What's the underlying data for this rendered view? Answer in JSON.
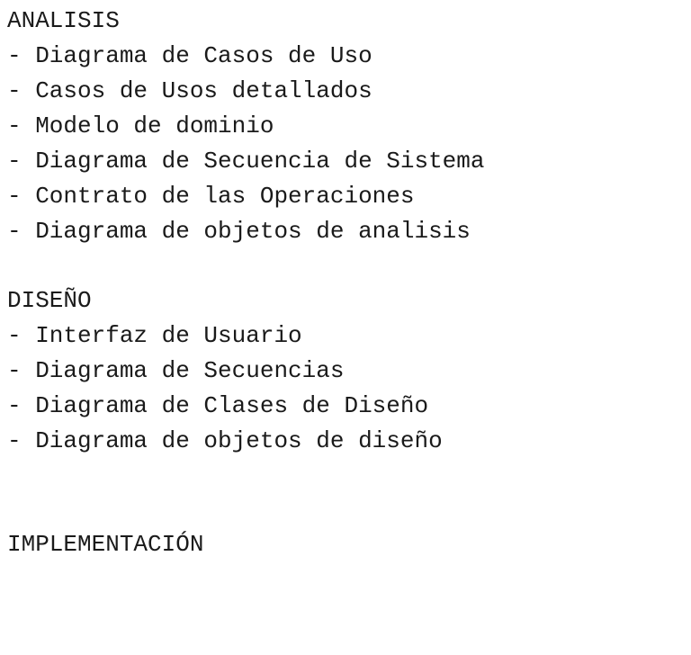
{
  "sections": [
    {
      "title": "ANALISIS",
      "items": [
        "- Diagrama de Casos de Uso",
        "- Casos de Usos detallados",
        "- Modelo de dominio",
        "- Diagrama de Secuencia de Sistema",
        "- Contrato de las Operaciones",
        "- Diagrama de objetos de analisis"
      ]
    },
    {
      "title": "DISEÑO",
      "items": [
        "- Interfaz de Usuario",
        "- Diagrama de Secuencias",
        "- Diagrama de Clases de Diseño",
        "- Diagrama de objetos de diseño"
      ]
    },
    {
      "title": "IMPLEMENTACIÓN",
      "items": []
    }
  ]
}
